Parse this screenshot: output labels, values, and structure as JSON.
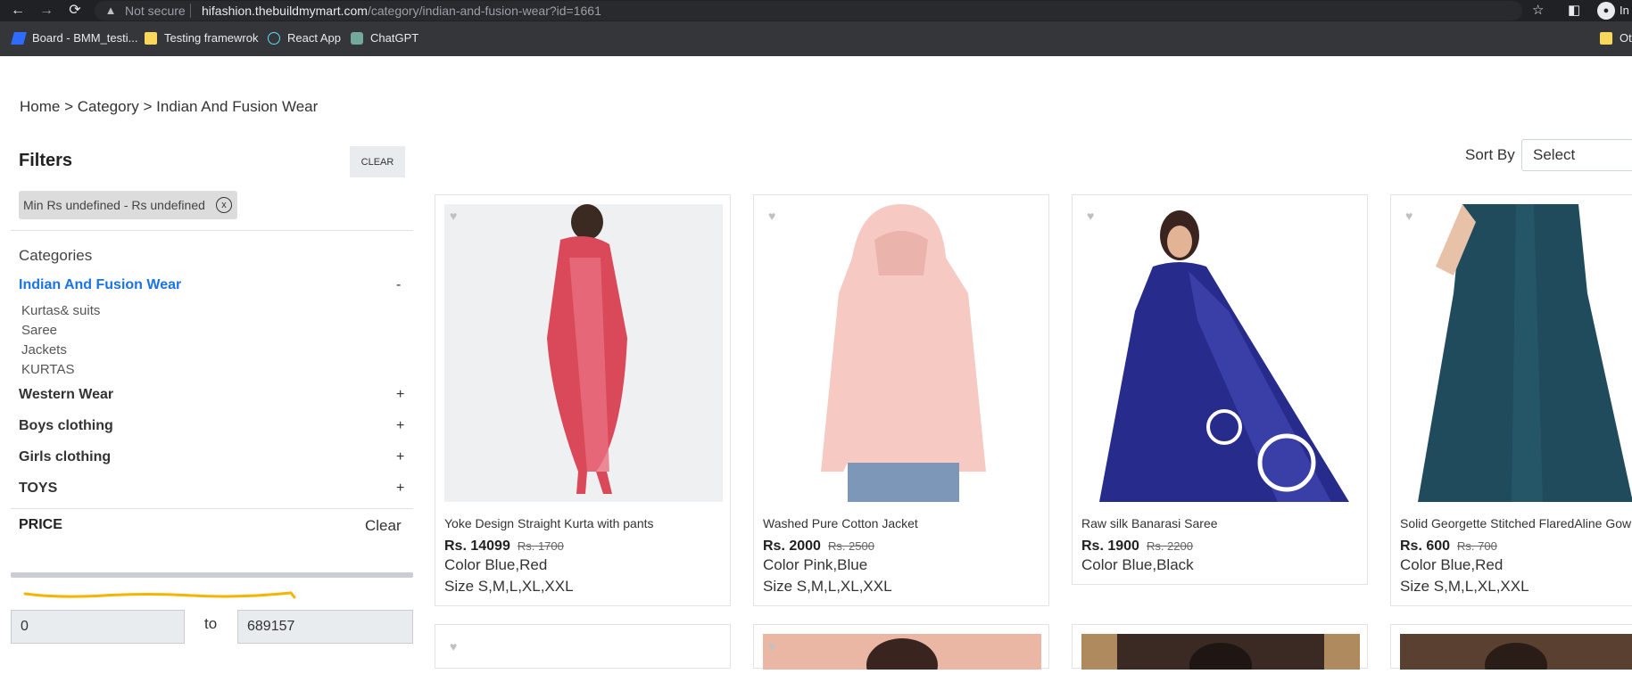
{
  "browser": {
    "security_label": "Not secure",
    "url_host": "hifashion.thebuildmymart.com",
    "url_path": "/category/indian-and-fusion-wear?id=1661",
    "profile_label": "In",
    "bookmarks": [
      {
        "label": "Board - BMM_testi..."
      },
      {
        "label": "Testing framewrok"
      },
      {
        "label": "React App"
      },
      {
        "label": "ChatGPT"
      },
      {
        "label": "Ot"
      }
    ]
  },
  "breadcrumb": [
    "Home",
    "Category",
    "Indian And Fusion Wear"
  ],
  "breadcrumb_sep": ">",
  "filters": {
    "title": "Filters",
    "clear_label": "CLEAR",
    "chip_text": "Min Rs undefined - Rs undefined",
    "chip_close": "x"
  },
  "categories": {
    "heading": "Categories",
    "active": {
      "label": "Indian And Fusion Wear",
      "toggle": "-"
    },
    "subcategories": [
      "Kurtas& suits",
      "Saree",
      "Jackets",
      "KURTAS"
    ],
    "others": [
      {
        "label": "Western Wear",
        "toggle": "+"
      },
      {
        "label": "Boys clothing",
        "toggle": "+"
      },
      {
        "label": "Girls clothing",
        "toggle": "+"
      },
      {
        "label": "TOYS",
        "toggle": "+"
      }
    ]
  },
  "price": {
    "title": "PRICE",
    "clear_label": "Clear",
    "min_value": "0",
    "to_label": "to",
    "max_value": "689157"
  },
  "sort": {
    "label": "Sort By",
    "selected": "Select"
  },
  "products": [
    {
      "name": "Yoke Design Straight Kurta with pants",
      "price": "Rs. 14099",
      "old_price": "Rs. 1700",
      "color": "Color Blue,Red",
      "size": "Size S,M,L,XL,XXL"
    },
    {
      "name": "Washed Pure Cotton Jacket",
      "price": "Rs. 2000",
      "old_price": "Rs. 2500",
      "color": "Color Pink,Blue",
      "size": "Size S,M,L,XL,XXL"
    },
    {
      "name": "Raw silk Banarasi Saree",
      "price": "Rs. 1900",
      "old_price": "Rs. 2200",
      "color": "Color Blue,Black",
      "size": ""
    },
    {
      "name": "Solid Georgette Stitched FlaredAline Gown",
      "price": "Rs. 600",
      "old_price": "Rs. 700",
      "color": "Color Blue,Red",
      "size": "Size S,M,L,XL,XXL"
    }
  ],
  "colors": {
    "accent": "#1a73e8",
    "chrome_dark": "#202124",
    "bookmark_bar": "#35363a",
    "annotation": "#f5b400"
  }
}
